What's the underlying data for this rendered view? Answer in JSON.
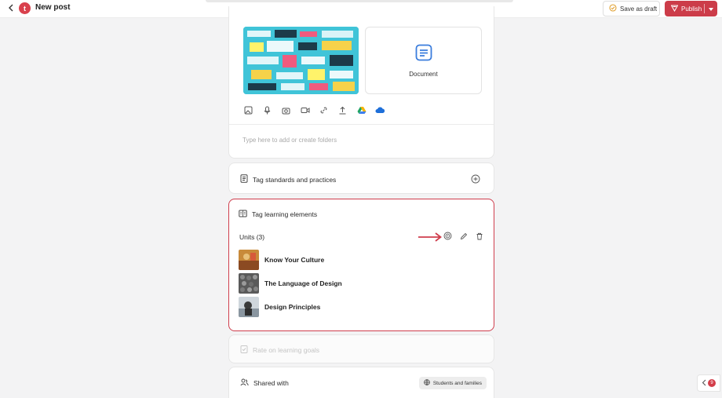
{
  "header": {
    "logo_letter": "t",
    "title": "New post",
    "save_draft_label": "Save as draft",
    "publish_label": "Publish"
  },
  "attachments": {
    "document_label": "Document",
    "media_icons": [
      "image-icon",
      "microphone-icon",
      "camera-icon",
      "video-icon",
      "link-icon",
      "upload-icon",
      "google-drive-icon",
      "onedrive-icon"
    ]
  },
  "folders": {
    "placeholder": "Type here to add or create folders"
  },
  "standards": {
    "label": "Tag standards and practices"
  },
  "learning_elements": {
    "label": "Tag learning elements",
    "units_label": "Units (3)",
    "units": [
      {
        "name": "Know Your Culture"
      },
      {
        "name": "The Language of Design"
      },
      {
        "name": "Design Principles"
      }
    ]
  },
  "rate": {
    "label": "Rate on learning goals"
  },
  "shared": {
    "label": "Shared with",
    "audience": "Students and families"
  },
  "side_panel": {
    "badge_count": "9"
  },
  "colors": {
    "accent": "#cc3c49",
    "highlight_border": "#cf3e4d",
    "doc_icon": "#3b7ddd",
    "background": "#f3f3f4"
  }
}
